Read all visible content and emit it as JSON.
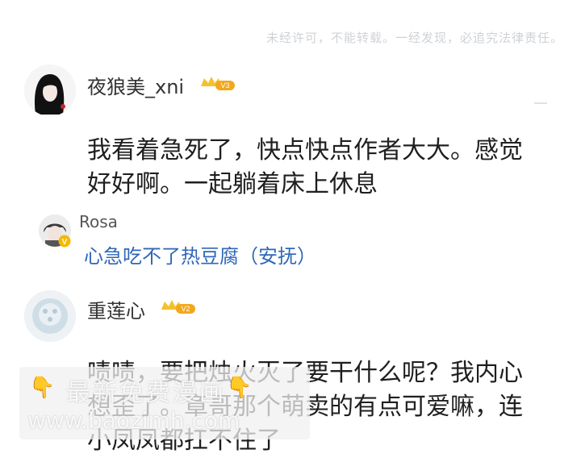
{
  "notice": "未经许可，不能转载。一经发现，必追究法律责任。",
  "comments": [
    {
      "username": "夜狼美_xni",
      "level": "V3",
      "text_line1": "我看着急死了，快点快点作者大大。感觉",
      "text_line2": "好好啊。一起躺着床上休息",
      "reply": {
        "username": "Rosa",
        "verified": "V",
        "text": "心急吃不了热豆腐（安抚）"
      }
    },
    {
      "username": "重莲心",
      "level": "V2",
      "text_line1": "啧啧，要把烛火灭了要干什么呢？我内心",
      "text_line2": "想歪了。章哥那个萌卖的有点可爱嘛，连",
      "text_line3": "小凤凤都扛不住了"
    }
  ],
  "watermark": {
    "line1": "最新免费漫画",
    "line2": "www.baozimh.com"
  },
  "colors": {
    "reply_text": "#2f67b8",
    "badge_gold": "#f2a81d",
    "notice": "#cfd2d6"
  }
}
